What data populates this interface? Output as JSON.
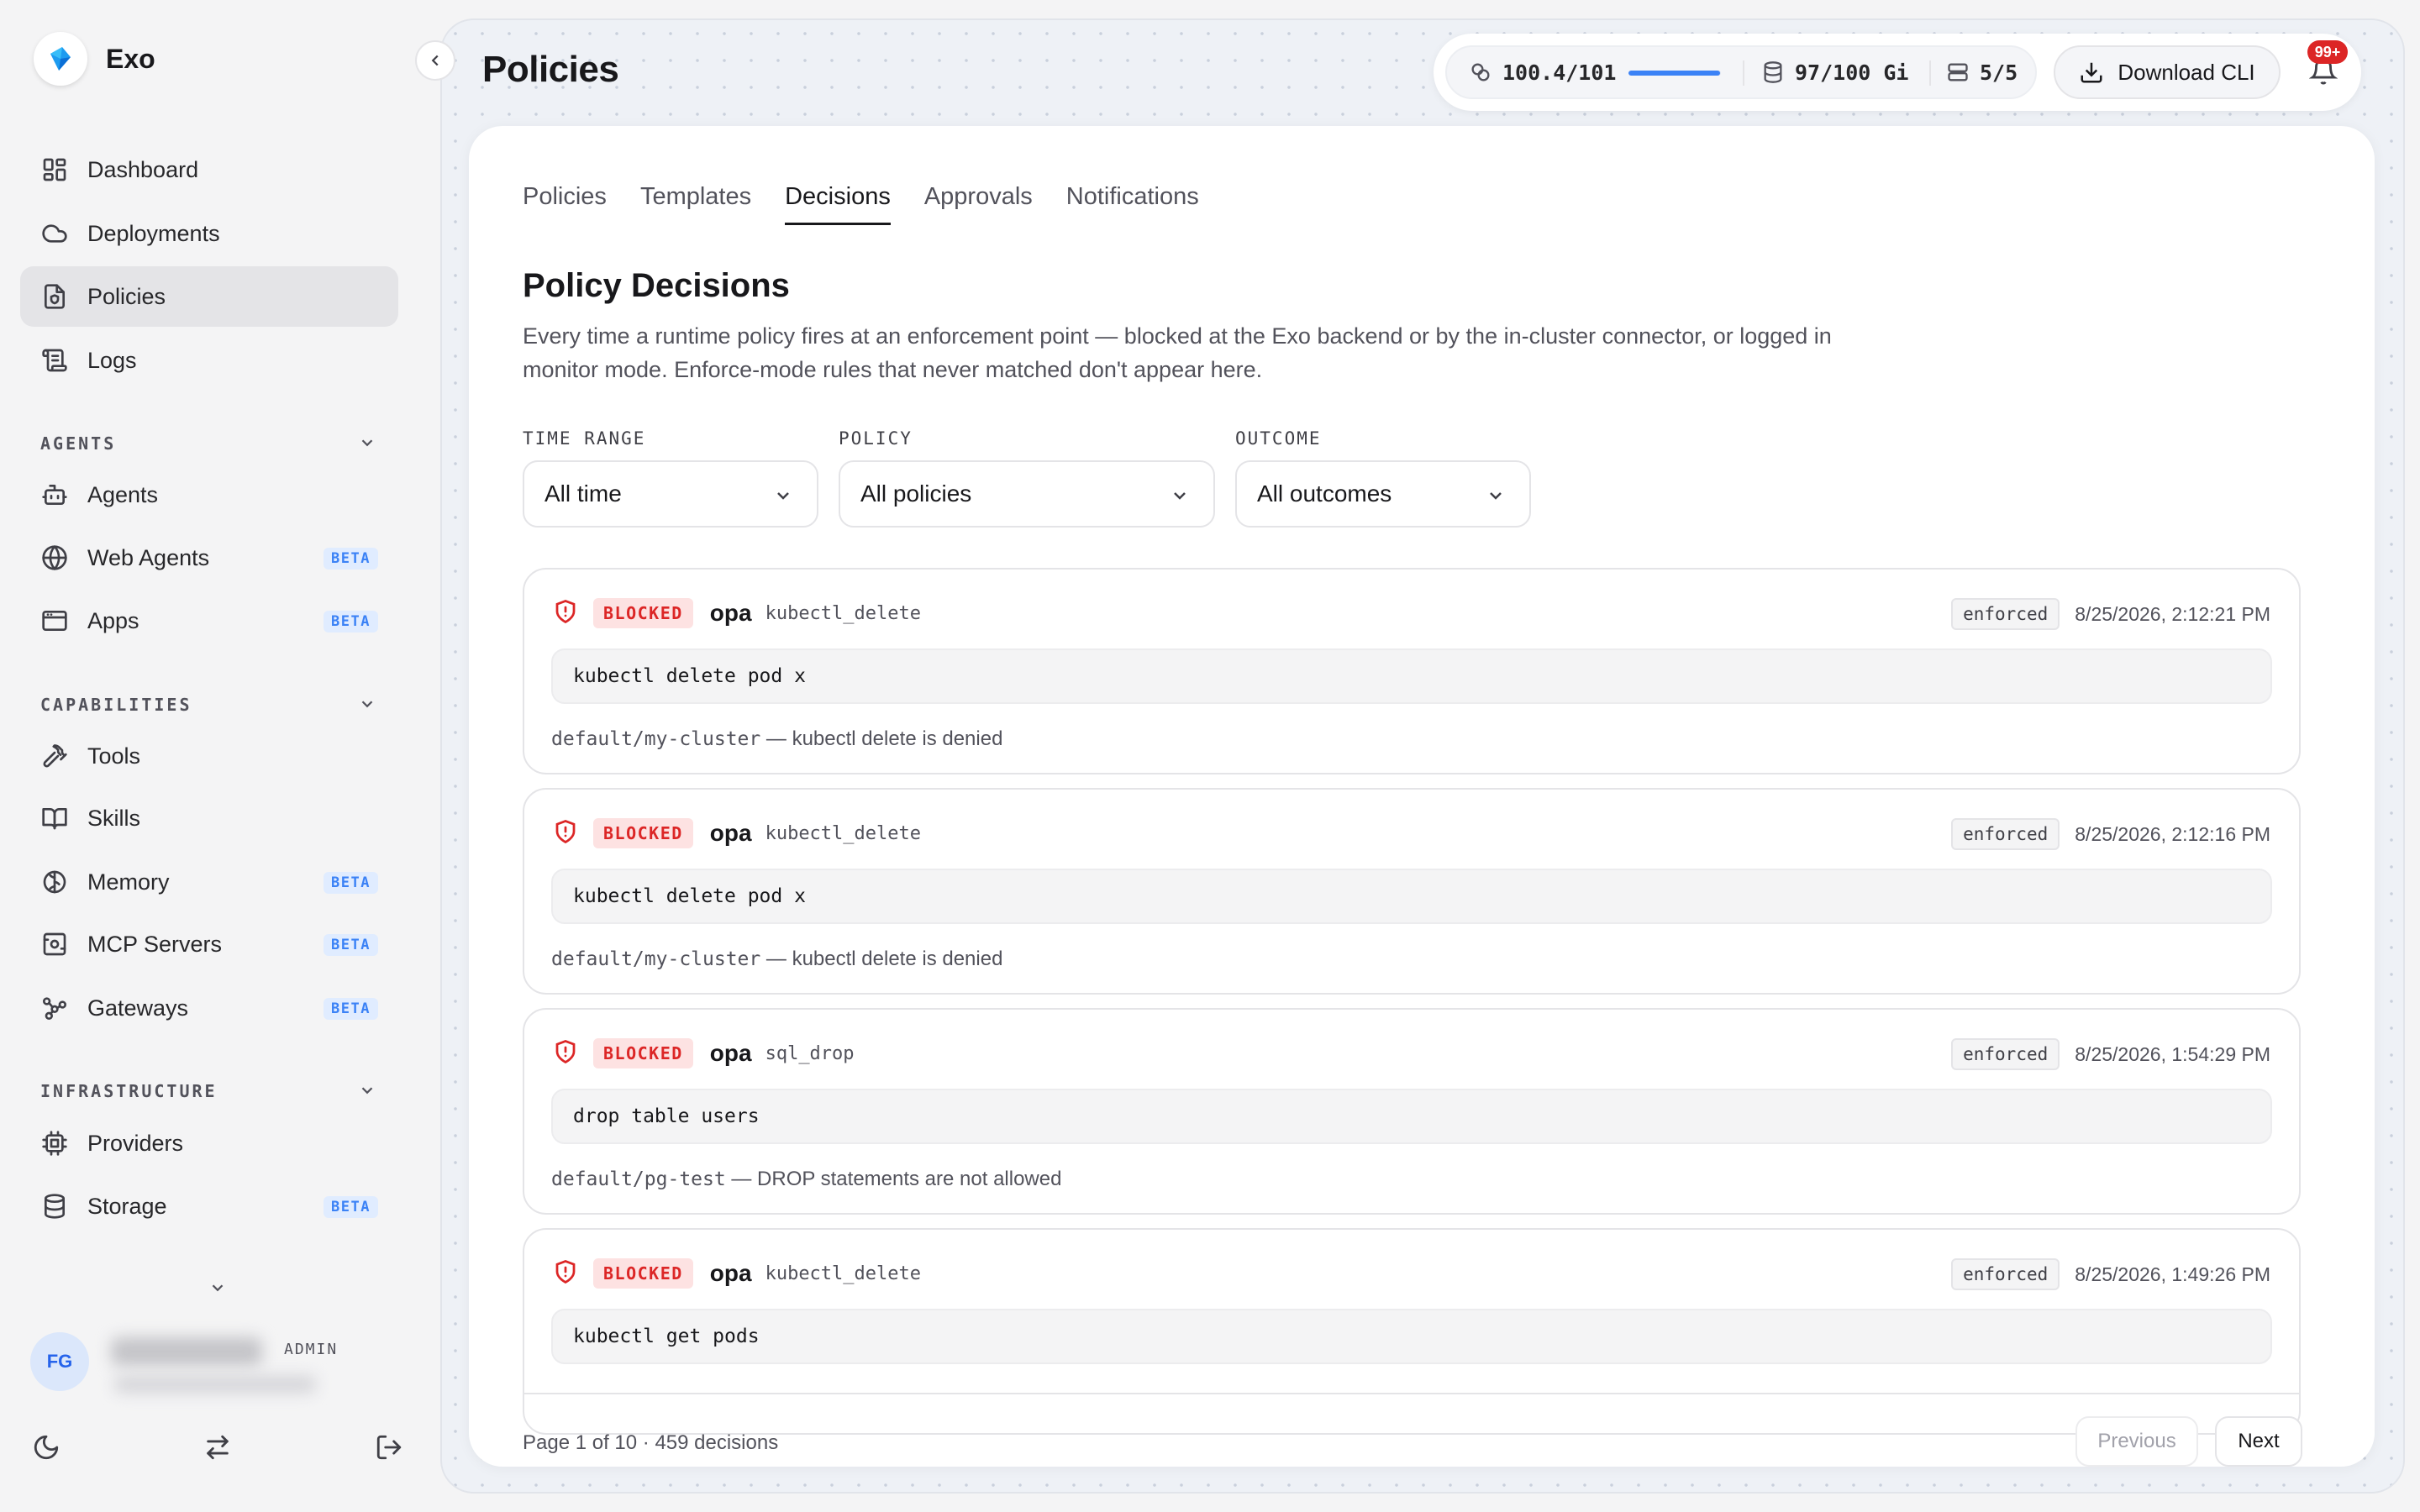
{
  "app": {
    "name": "Exo"
  },
  "page": {
    "title": "Policies"
  },
  "sidebar": {
    "main_items": [
      {
        "label": "Dashboard",
        "icon": "dashboard-icon"
      },
      {
        "label": "Deployments",
        "icon": "cloud-icon"
      },
      {
        "label": "Policies",
        "icon": "policy-document-icon",
        "active": true
      },
      {
        "label": "Logs",
        "icon": "logs-icon"
      }
    ],
    "sections": [
      {
        "label": "AGENTS",
        "items": [
          {
            "label": "Agents",
            "icon": "robot-icon"
          },
          {
            "label": "Web Agents",
            "icon": "globe-icon",
            "badge": "BETA"
          },
          {
            "label": "Apps",
            "icon": "app-window-icon",
            "badge": "BETA"
          }
        ]
      },
      {
        "label": "CAPABILITIES",
        "items": [
          {
            "label": "Tools",
            "icon": "hammer-icon"
          },
          {
            "label": "Skills",
            "icon": "book-icon"
          },
          {
            "label": "Memory",
            "icon": "brain-icon",
            "badge": "BETA"
          },
          {
            "label": "MCP Servers",
            "icon": "server-icon",
            "badge": "BETA"
          },
          {
            "label": "Gateways",
            "icon": "network-icon",
            "badge": "BETA"
          }
        ]
      },
      {
        "label": "INFRASTRUCTURE",
        "items": [
          {
            "label": "Providers",
            "icon": "chip-icon"
          },
          {
            "label": "Storage",
            "icon": "database-icon",
            "badge": "BETA"
          }
        ]
      }
    ],
    "user": {
      "initials": "FG",
      "role": "ADMIN"
    }
  },
  "topbar": {
    "cpu": "100.4/101",
    "cpu_usage_fraction": 0.994,
    "memory": "97/100 Gi",
    "nodes": "5/5",
    "download_label": "Download CLI",
    "notifications_badge": "99+"
  },
  "tabs": [
    "Policies",
    "Templates",
    "Decisions",
    "Approvals",
    "Notifications"
  ],
  "active_tab": "Decisions",
  "section": {
    "title": "Policy Decisions",
    "description": "Every time a runtime policy fires at an enforcement point — blocked at the Exo backend or by the in-cluster connector, or logged in monitor mode. Enforce-mode rules that never matched don't appear here."
  },
  "filters": {
    "time_range": {
      "label": "TIME RANGE",
      "value": "All time"
    },
    "policy": {
      "label": "POLICY",
      "value": "All policies"
    },
    "outcome": {
      "label": "OUTCOME",
      "value": "All outcomes"
    }
  },
  "decisions": [
    {
      "outcome": "BLOCKED",
      "engine": "opa",
      "rule": "kubectl_delete",
      "mode": "enforced",
      "timestamp": "8/25/2026, 2:12:21 PM",
      "command": "kubectl delete pod x",
      "target": "default/my-cluster",
      "message": " — kubectl delete is denied"
    },
    {
      "outcome": "BLOCKED",
      "engine": "opa",
      "rule": "kubectl_delete",
      "mode": "enforced",
      "timestamp": "8/25/2026, 2:12:16 PM",
      "command": "kubectl delete pod x",
      "target": "default/my-cluster",
      "message": " — kubectl delete is denied"
    },
    {
      "outcome": "BLOCKED",
      "engine": "opa",
      "rule": "sql_drop",
      "mode": "enforced",
      "timestamp": "8/25/2026, 1:54:29 PM",
      "command": "drop table users",
      "target": "default/pg-test",
      "message": " — DROP statements are not allowed"
    },
    {
      "outcome": "BLOCKED",
      "engine": "opa",
      "rule": "kubectl_delete",
      "mode": "enforced",
      "timestamp": "8/25/2026, 1:49:26 PM",
      "command": "kubectl get pods",
      "target": "",
      "message": ""
    }
  ],
  "pagination": {
    "info": "Page 1 of 10 · 459 decisions",
    "previous": "Previous",
    "next": "Next"
  },
  "colors": {
    "accent": "#3b82f6",
    "blocked": "#dc2626",
    "badge_bg": "#fde2e2"
  }
}
